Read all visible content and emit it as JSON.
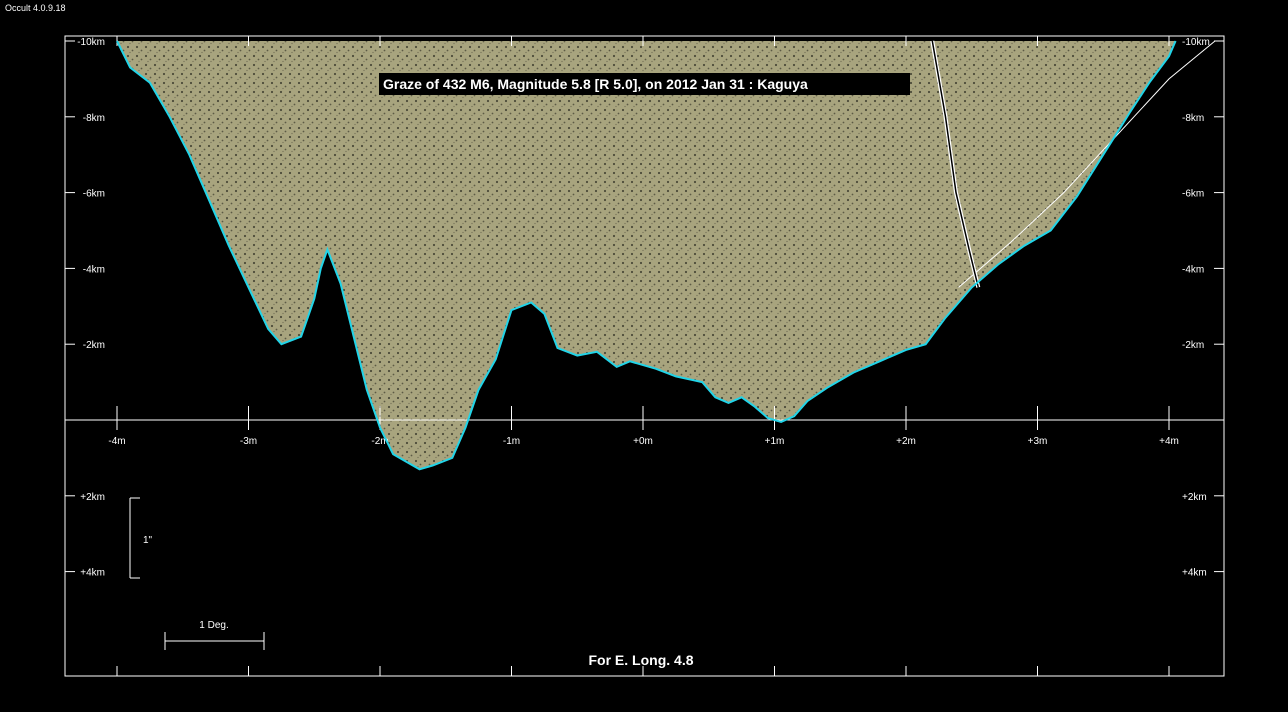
{
  "app": {
    "title": "Occult 4.0.9.18"
  },
  "chart_data": {
    "type": "line",
    "title": "Graze of  432 M6,  Magnitude 5.8 [R 5.0],  on 2012 Jan 31  :  Kaguya",
    "footer": "For E. Long. 4.8",
    "x_axis": {
      "unit": "m",
      "ticks": [
        -4,
        -3,
        -2,
        -1,
        0,
        1,
        2,
        3,
        4
      ],
      "tick_labels": [
        "-4m",
        "-3m",
        "-2m",
        "-1m",
        "+0m",
        "+1m",
        "+2m",
        "+3m",
        "+4m"
      ]
    },
    "y_axis": {
      "unit": "km",
      "range": [
        -10,
        4
      ],
      "tick_values": [
        -10,
        -8,
        -6,
        -4,
        -2,
        2,
        4
      ],
      "tick_labels": [
        "-10km",
        "-8km",
        "-6km",
        "-4km",
        "-2km",
        "+2km",
        "+4km"
      ]
    },
    "scale_bars": {
      "vertical_label": "1\"",
      "horizontal_label": "1 Deg."
    },
    "colors": {
      "profile": "#22d4e8",
      "terrain": "#a8a47e",
      "background": "#000000",
      "axes": "#ffffff"
    },
    "series": [
      {
        "kind": "limb-profile",
        "points": [
          [
            -4.0,
            -10.0
          ],
          [
            -3.9,
            -9.3
          ],
          [
            -3.75,
            -8.9
          ],
          [
            -3.6,
            -8.0
          ],
          [
            -3.45,
            -7.0
          ],
          [
            -3.3,
            -5.8
          ],
          [
            -3.15,
            -4.6
          ],
          [
            -3.0,
            -3.5
          ],
          [
            -2.85,
            -2.4
          ],
          [
            -2.75,
            -2.0
          ],
          [
            -2.6,
            -2.2
          ],
          [
            -2.5,
            -3.2
          ],
          [
            -2.45,
            -4.0
          ],
          [
            -2.4,
            -4.5
          ],
          [
            -2.3,
            -3.6
          ],
          [
            -2.2,
            -2.2
          ],
          [
            -2.1,
            -0.8
          ],
          [
            -2.0,
            0.2
          ],
          [
            -1.9,
            0.9
          ],
          [
            -1.8,
            1.1
          ],
          [
            -1.7,
            1.3
          ],
          [
            -1.6,
            1.2
          ],
          [
            -1.45,
            1.0
          ],
          [
            -1.35,
            0.2
          ],
          [
            -1.25,
            -0.8
          ],
          [
            -1.12,
            -1.6
          ],
          [
            -1.0,
            -2.9
          ],
          [
            -0.85,
            -3.1
          ],
          [
            -0.75,
            -2.8
          ],
          [
            -0.65,
            -1.9
          ],
          [
            -0.5,
            -1.7
          ],
          [
            -0.35,
            -1.8
          ],
          [
            -0.2,
            -1.4
          ],
          [
            -0.1,
            -1.55
          ],
          [
            0.1,
            -1.35
          ],
          [
            0.25,
            -1.15
          ],
          [
            0.45,
            -1.0
          ],
          [
            0.55,
            -0.6
          ],
          [
            0.65,
            -0.45
          ],
          [
            0.75,
            -0.6
          ],
          [
            0.85,
            -0.35
          ],
          [
            0.95,
            -0.05
          ],
          [
            1.05,
            0.05
          ],
          [
            1.15,
            -0.1
          ],
          [
            1.25,
            -0.5
          ],
          [
            1.4,
            -0.85
          ],
          [
            1.6,
            -1.25
          ],
          [
            1.8,
            -1.55
          ],
          [
            2.0,
            -1.85
          ],
          [
            2.15,
            -2.0
          ],
          [
            2.3,
            -2.7
          ],
          [
            2.5,
            -3.5
          ],
          [
            2.7,
            -4.1
          ],
          [
            2.9,
            -4.6
          ],
          [
            3.1,
            -5.0
          ],
          [
            3.3,
            -5.9
          ],
          [
            3.5,
            -7.0
          ],
          [
            3.7,
            -8.1
          ],
          [
            3.85,
            -8.9
          ],
          [
            4.0,
            -9.6
          ],
          [
            4.05,
            -10.0
          ]
        ]
      },
      {
        "kind": "moon-limb-curve",
        "points": [
          [
            2.4,
            -3.5
          ],
          [
            2.8,
            -4.7
          ],
          [
            3.2,
            -6.0
          ],
          [
            3.6,
            -7.5
          ],
          [
            4.0,
            -9.0
          ],
          [
            4.35,
            -10.0
          ]
        ]
      },
      {
        "kind": "path-line",
        "points": [
          [
            2.2,
            -10.0
          ],
          [
            2.3,
            -8.0
          ],
          [
            2.38,
            -6.0
          ],
          [
            2.48,
            -4.5
          ],
          [
            2.55,
            -3.5
          ]
        ]
      }
    ]
  }
}
